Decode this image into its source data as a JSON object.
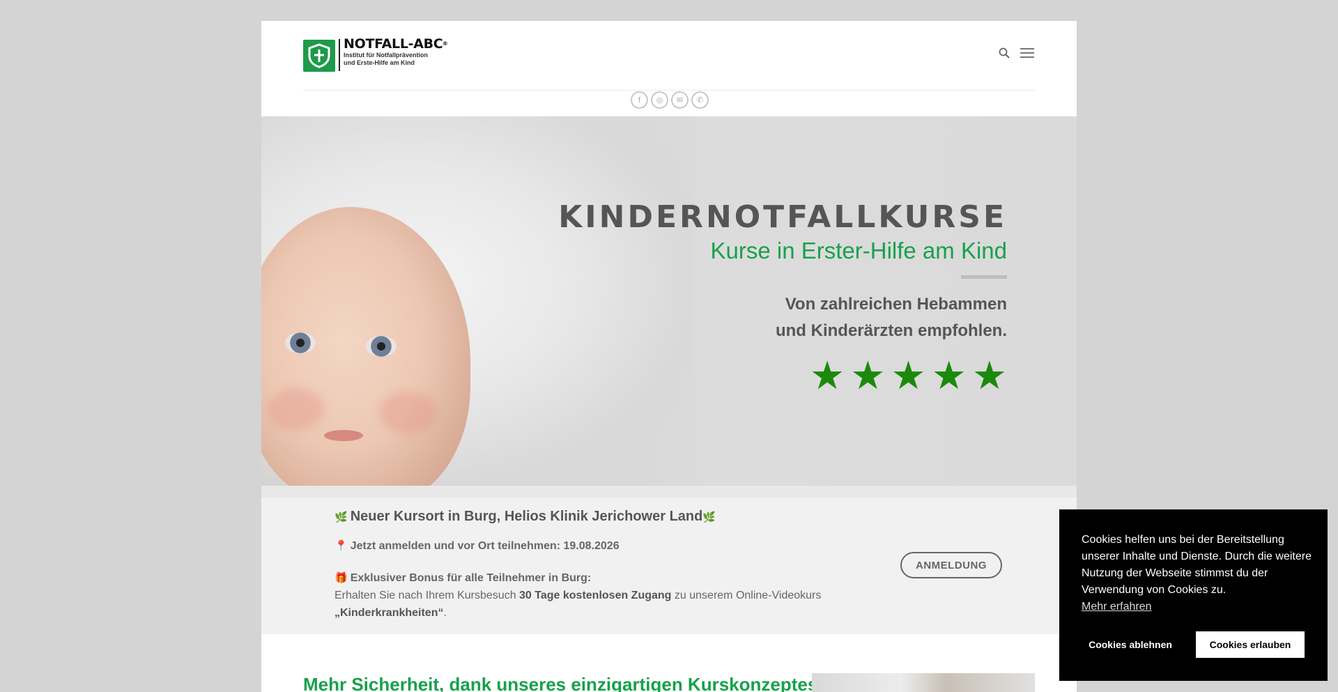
{
  "header": {
    "logo_title": "NOTFALL-ABC",
    "logo_mark": "®",
    "logo_sub_1": "Institut für Notfallprävention",
    "logo_sub_2": "und Erste-Hilfe am Kind",
    "icons": [
      "search-icon",
      "menu-icon"
    ],
    "social": [
      {
        "name": "facebook-icon",
        "glyph": "f"
      },
      {
        "name": "instagram-icon",
        "glyph": "◎"
      },
      {
        "name": "email-icon",
        "glyph": "✉"
      },
      {
        "name": "phone-icon",
        "glyph": "✆"
      }
    ]
  },
  "hero": {
    "title": "KINDERNOTFALLKURSE",
    "subtitle": "Kurse in Erster-Hilfe am Kind",
    "recommend_1": "Von zahlreichen Hebammen",
    "recommend_2": "und Kinderärzten empfohlen.",
    "rating": 5,
    "star_glyph": "★"
  },
  "announcement": {
    "emoji_plant": "🌿",
    "title": "Neuer Kursort in Burg,  Helios Klinik Jerichower Land",
    "emoji_pin": "📍",
    "line1": "Jetzt anmelden und vor Ort teilnehmen: 19.08.2026",
    "emoji_gift": "🎁",
    "line2": "Exklusiver Bonus für alle Teilnehmer in Burg:",
    "line3_a": "Erhalten Sie nach Ihrem Kursbesuch ",
    "line3_b": "30 Tage kostenlosen Zugang",
    "line3_c": " zu unserem Online-Videokurs",
    "line4_a": "„Kinderkrankheiten“",
    "line4_b": ".",
    "button_label": "ANMELDUNG"
  },
  "lower": {
    "title": "Mehr Sicherheit, dank unseres einzigartigen Kurskonzeptes."
  },
  "cookie": {
    "message": "Cookies helfen uns bei der Bereitstellung unserer Inhalte und Dienste. Durch die weitere Nutzung der Webseite stimmst du der Verwendung von Cookies zu.",
    "link": "Mehr erfahren",
    "deny": "Cookies ablehnen",
    "allow": "Cookies erlauben"
  },
  "colors": {
    "brand_green": "#17a14b",
    "star_green": "#1b8a0c",
    "text_gray": "#555555",
    "cookie_bg": "#000000"
  }
}
